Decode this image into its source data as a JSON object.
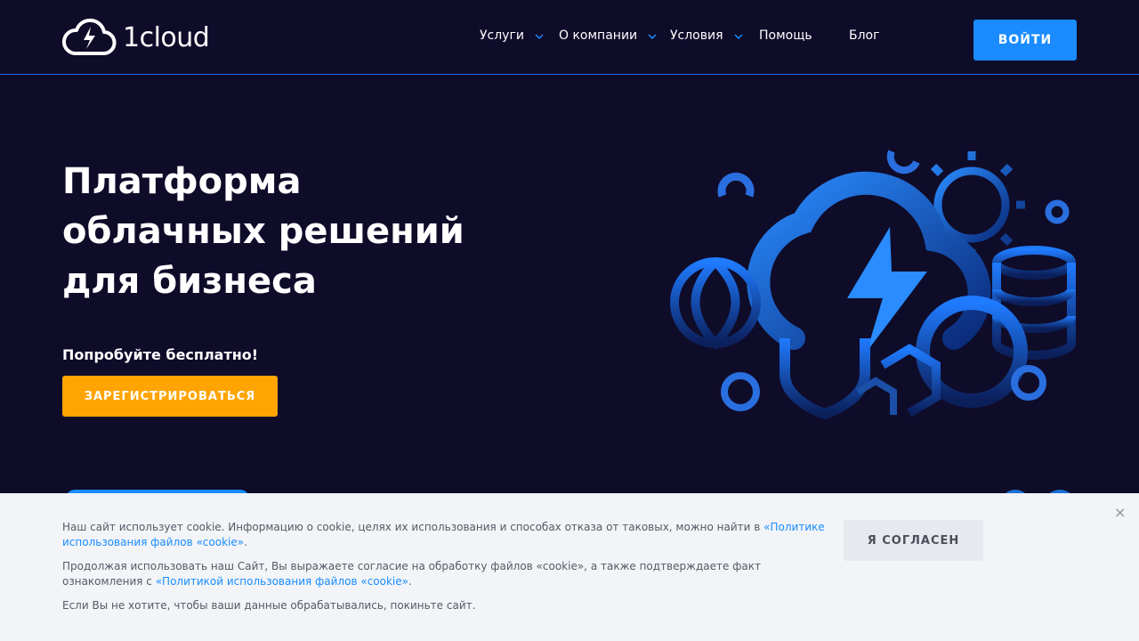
{
  "header": {
    "logo_text": "1cloud",
    "nav": [
      {
        "label": "Услуги",
        "has_dropdown": true
      },
      {
        "label": "О компании",
        "has_dropdown": true
      },
      {
        "label": "Условия",
        "has_dropdown": true
      },
      {
        "label": "Помощь",
        "has_dropdown": false
      },
      {
        "label": "Блог",
        "has_dropdown": false
      }
    ],
    "login_label": "ВОЙТИ"
  },
  "hero": {
    "title_lines": [
      "Платформа",
      "облачных решений",
      "для бизнеса"
    ],
    "subtitle": "Попробуйте бесплатно!",
    "register_label": "ЗАРЕГИСТРИРОВАТЬСЯ"
  },
  "cookie": {
    "p1_text": "Наш сайт использует cookie. Информацию о cookie, целях их использования и способах отказа от таковых, можно найти в ",
    "p1_link": "«Политике использования файлов «cookie»",
    "p1_end": ".",
    "p2_text": "Продолжая использовать наш Сайт, Вы выражаете согласие на обработку файлов «cookie», а также подтверждаете факт ознакомления с ",
    "p2_link": "«Политикой использования файлов «cookie»",
    "p2_end": ".",
    "p3_text": "Если Вы не хотите, чтобы ваши данные обрабатывались, покиньте сайт.",
    "agree_label": "Я СОГЛАСЕН",
    "close_glyph": "×"
  },
  "colors": {
    "background": "#0f0c2a",
    "accent_blue": "#1a8cff",
    "accent_orange": "#ffa400",
    "cookie_bg": "#f2f4f7"
  },
  "icons": [
    "cloud-bolt-logo-icon",
    "chevron-down-icon",
    "close-icon"
  ]
}
